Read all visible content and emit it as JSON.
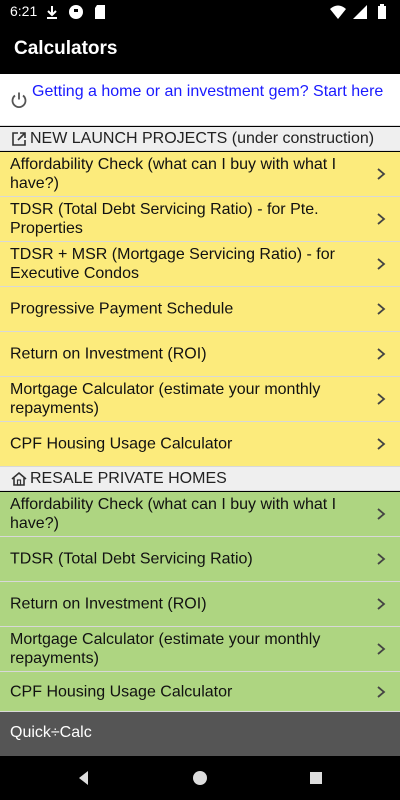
{
  "status_bar": {
    "time": "6:21",
    "left_icons": [
      "download-icon",
      "app-notification-icon",
      "sd-card-icon"
    ],
    "right_icons": [
      "wifi-icon",
      "signal-icon",
      "battery-icon"
    ]
  },
  "app_bar": {
    "title": "Calculators"
  },
  "promo": {
    "text": "Getting a home or an investment gem? Start here",
    "icon": "power-icon",
    "color": "#1a1aff"
  },
  "sections": [
    {
      "header": "NEW LAUNCH PROJECTS (under construction)",
      "icon": "open-external-icon",
      "color": "#fceb7c",
      "items": [
        {
          "label": "Affordability Check (what can I buy with what I have?)"
        },
        {
          "label": "TDSR (Total Debt Servicing Ratio) - for Pte. Properties"
        },
        {
          "label": "TDSR + MSR (Mortgage Servicing Ratio) - for Executive Condos"
        },
        {
          "label": "Progressive Payment Schedule"
        },
        {
          "label": "Return on Investment (ROI)"
        },
        {
          "label": "Mortgage Calculator (estimate your monthly repayments)"
        },
        {
          "label": "CPF Housing Usage Calculator"
        }
      ]
    },
    {
      "header": "RESALE PRIVATE HOMES",
      "icon": "house-icon",
      "color": "#aed581",
      "items": [
        {
          "label": "Affordability Check (what can I buy with what I have?)"
        },
        {
          "label": "TDSR (Total Debt Servicing Ratio)"
        },
        {
          "label": "Return on Investment (ROI)"
        },
        {
          "label": "Mortgage Calculator (estimate your monthly repayments)"
        },
        {
          "label": "CPF Housing Usage Calculator"
        }
      ]
    }
  ],
  "quick_calc": {
    "label": "Quick÷Calc"
  },
  "nav_bar": {
    "buttons": [
      "back-icon",
      "home-icon",
      "recents-icon"
    ]
  }
}
